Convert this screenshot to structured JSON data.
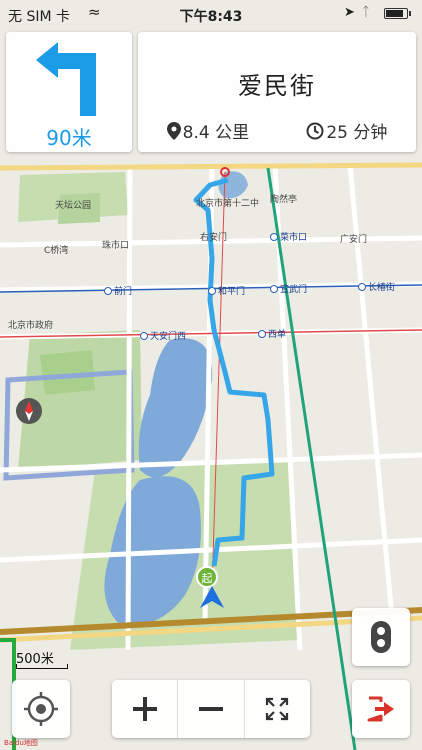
{
  "status": {
    "carrier": "无 SIM 卡",
    "time": "下午8:43",
    "battery_level": 0.9
  },
  "navigation": {
    "distance_to_turn": "90米",
    "road_name": "爱民街",
    "remaining_distance": "8.4 公里",
    "remaining_time": "25 分钟",
    "turn_icon": "turn-left-arrow-icon",
    "accent_color": "#1c9be6"
  },
  "map": {
    "labels": [
      "北京市第十二中",
      "陶然亭",
      "右安门",
      "菜市口",
      "广安门",
      "珠市口",
      "天坛公园",
      "北京市政府",
      "前门",
      "和平门",
      "宣武门",
      "长椿街",
      "天安门西",
      "西单",
      "C桥湾"
    ],
    "scale_label": "500米",
    "start_marker": "起",
    "route_color": "#36a6e8"
  },
  "controls": {
    "locate": "locate-icon",
    "zoom_in": "plus-icon",
    "zoom_out": "minus-icon",
    "fullscreen": "fullscreen-icon",
    "traffic": "traffic-light-icon",
    "exit": "exit-icon"
  }
}
